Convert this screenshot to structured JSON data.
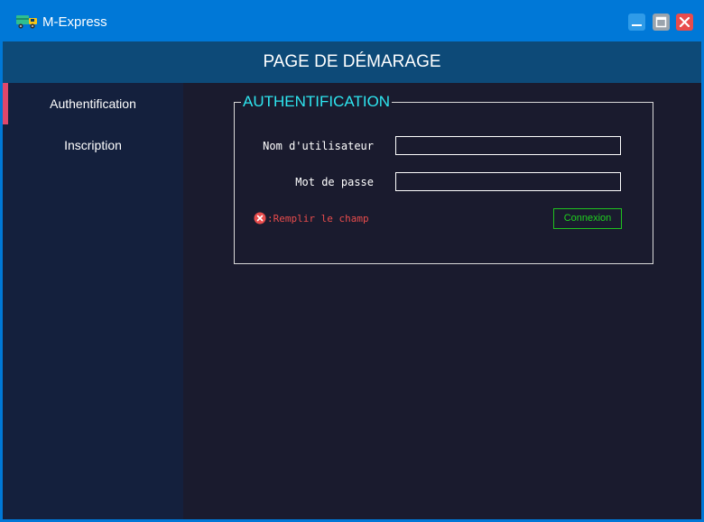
{
  "window": {
    "title": "M-Express",
    "app_icon": "truck-icon",
    "controls": [
      "minimize-icon",
      "maximize-icon",
      "close-icon"
    ]
  },
  "header": {
    "title": "PAGE DE DÉMARAGE"
  },
  "sidebar": {
    "items": [
      {
        "label": "Authentification",
        "active": true
      },
      {
        "label": "Inscription",
        "active": false
      }
    ]
  },
  "auth": {
    "legend": "AUTHENTIFICATION",
    "username_label": "Nom d'utilisateur",
    "username_value": "",
    "password_label": "Mot de passe",
    "password_value": "",
    "error_icon": "error-circle-icon",
    "error_text": ":Remplir le champ",
    "connect_label": "Connexion"
  },
  "colors": {
    "titlebar": "#0078d7",
    "header": "#0d4a78",
    "sidebar": "#14203d",
    "main": "#1a1b2e",
    "active_marker": "#e0476b",
    "legend": "#2ee6f0",
    "error": "#e84c4c",
    "connect": "#1fd21f"
  }
}
